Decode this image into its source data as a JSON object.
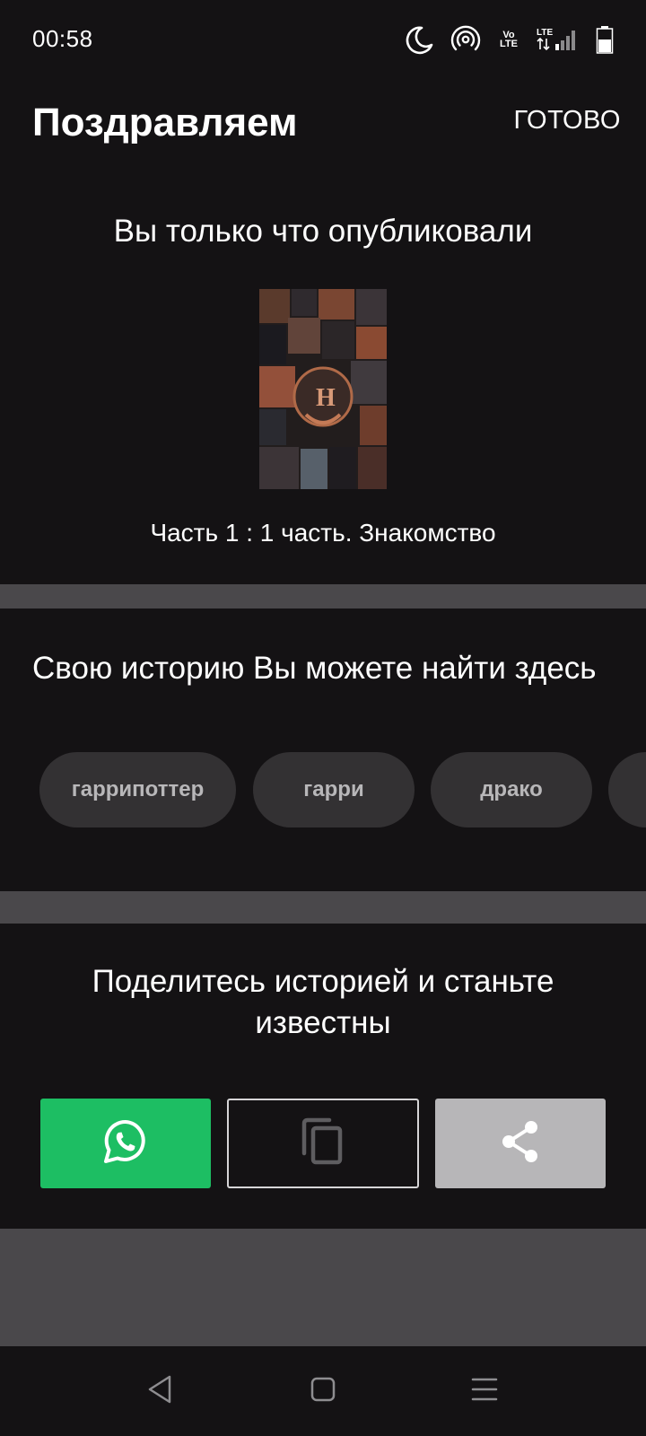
{
  "status_bar": {
    "time": "00:58",
    "icons": [
      "moon-icon",
      "hotspot-icon",
      "volte-icon",
      "lte-signal-icon",
      "battery-icon"
    ],
    "volte_text": "Vo LTE",
    "lte_text": "LTE"
  },
  "header": {
    "title": "Поздравляем",
    "done_label": "ГОТОВО"
  },
  "published": {
    "heading": "Вы только что опубликовали",
    "cover_alt": "story-cover",
    "part_title": "Часть 1 : 1 часть. Знакомство"
  },
  "find": {
    "heading": "Свою историю Вы можете найти здесь",
    "tags": [
      "гаррипоттер",
      "гарри",
      "драко",
      ""
    ]
  },
  "share": {
    "heading": "Поделитесь историей и станьте известны",
    "buttons": [
      "whatsapp-icon",
      "copy-icon",
      "share-icon"
    ]
  },
  "colors": {
    "background": "#141214",
    "divider": "#4a484b",
    "tag_bg": "#333133",
    "whatsapp_green": "#1dbe63",
    "share_gray": "#b7b6b8"
  },
  "nav": {
    "buttons": [
      "back-icon",
      "home-icon",
      "recents-icon"
    ]
  }
}
